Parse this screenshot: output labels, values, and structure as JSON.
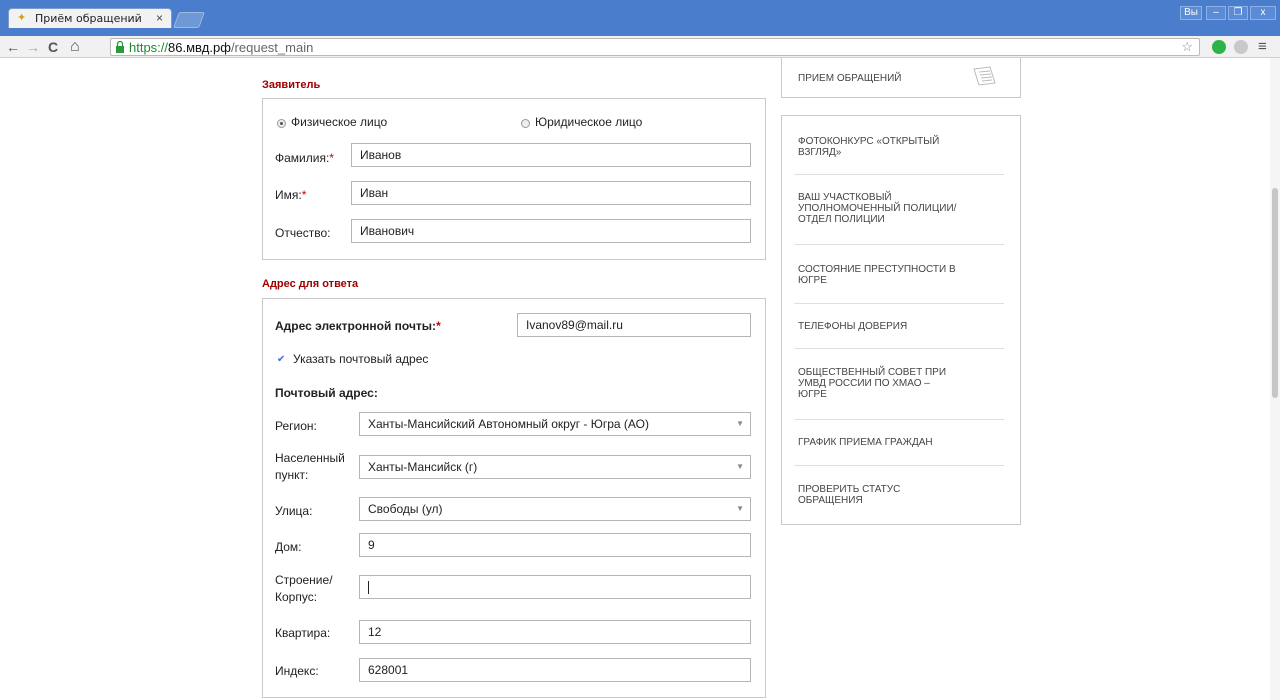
{
  "browser": {
    "tab_title": "Приём обращений",
    "tab_close": "×",
    "url_scheme": "https://",
    "url_host": "86.мвд.рф",
    "url_path": "/request_main",
    "window_user": "Вы",
    "nav_back": "←",
    "nav_forward": "→",
    "nav_reload": "C",
    "nav_home": "⌂",
    "star": "☆",
    "menu": "≡",
    "ctrl_min": "–",
    "ctrl_max": "❐",
    "ctrl_close": "x"
  },
  "applicant": {
    "section_title": "Заявитель",
    "radio_person": "Физическое лицо",
    "radio_legal": "Юридическое лицо",
    "surname_label": "Фамилия:",
    "surname_value": "Иванов",
    "name_label": "Имя:",
    "name_value": "Иван",
    "patronymic_label": "Отчество:",
    "patronymic_value": "Иванович",
    "required_mark": "*"
  },
  "address": {
    "section_title": "Адрес для ответа",
    "email_label": "Адрес электронной почты:",
    "email_value": "Ivanov89@mail.ru",
    "postal_checkbox_label": "Указать почтовый адрес",
    "postal_heading": "Почтовый адрес:",
    "region_label": "Регион:",
    "region_value": "Ханты-Мансийский Автономный округ - Югра (АО)",
    "locality_label_1": "Населенный",
    "locality_label_2": "пункт:",
    "locality_value": "Ханты-Мансийск (г)",
    "street_label": "Улица:",
    "street_value": "Свободы (ул)",
    "house_label": "Дом:",
    "house_value": "9",
    "building_label_1": "Строение/",
    "building_label_2": "Корпус:",
    "building_value": "",
    "flat_label": "Квартира:",
    "flat_value": "12",
    "index_label": "Индекс:",
    "index_value": "628001"
  },
  "sidebar": {
    "top_item": "Прием обращений",
    "items": [
      "Фотоконкурс «Открытый взгляд»",
      "Ваш участковый уполномоченный полиции/ отдел полиции",
      "Состояние преступности в Югре",
      "Телефоны доверия",
      "Общественный совет при УМВД России по ХМАО – Югре",
      "График приема граждан",
      "Проверить статус обращения"
    ]
  },
  "colors": {
    "section_title": "#a00000",
    "titlebar": "#4a7ecd",
    "secure_url": "#1c8a2e"
  }
}
